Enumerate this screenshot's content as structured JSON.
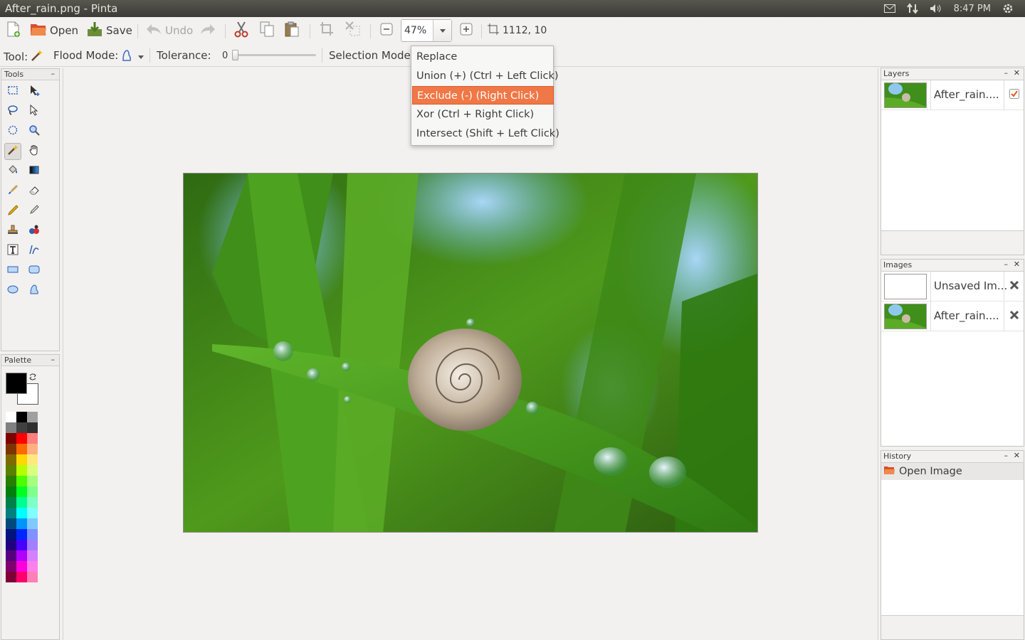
{
  "window": {
    "title": "After_rain.png - Pinta"
  },
  "tray": {
    "clock": "8:47 PM"
  },
  "toolbar": {
    "open_label": "Open",
    "save_label": "Save",
    "undo_label": "Undo",
    "zoom_value": "47%",
    "cursor_position": "1112, 10"
  },
  "tool_options": {
    "tool_label": "Tool:",
    "flood_mode_label": "Flood Mode:",
    "tolerance_label": "Tolerance:",
    "tolerance_value": "0",
    "tolerance_fraction": 0,
    "selection_mode_label": "Selection Mode:"
  },
  "selection_menu": {
    "items": [
      {
        "label": "Replace",
        "highlighted": false
      },
      {
        "label": "Union (+) (Ctrl + Left Click)",
        "highlighted": false
      },
      {
        "label": "Exclude (-) (Right Click)",
        "highlighted": true
      },
      {
        "label": "Xor (Ctrl + Right Click)",
        "highlighted": false
      },
      {
        "label": "Intersect (Shift + Left Click)",
        "highlighted": false
      }
    ]
  },
  "panels": {
    "tools_title": "Tools",
    "palette_title": "Palette",
    "layers_title": "Layers",
    "images_title": "Images",
    "history_title": "History"
  },
  "layers": [
    {
      "name": "After_rain....",
      "visible": true
    }
  ],
  "images": [
    {
      "name": "Unsaved Im..."
    },
    {
      "name": "After_rain...."
    }
  ],
  "history": [
    {
      "label": "Open Image"
    }
  ],
  "colors": {
    "accent": "#f07746",
    "primary_color": "#000000",
    "secondary_color": "#ffffff",
    "palette": [
      [
        "#ffffff",
        "#000000",
        "#a0a0a0"
      ],
      [
        "#808080",
        "#404040",
        "#303030"
      ],
      [
        "#7f0000",
        "#ff0000",
        "#ff7f7f"
      ],
      [
        "#7f3300",
        "#ff6a00",
        "#ffb27f"
      ],
      [
        "#7f6a00",
        "#ffd800",
        "#ffe97f"
      ],
      [
        "#5b7f00",
        "#b6ff00",
        "#daff7f"
      ],
      [
        "#267f00",
        "#4cff00",
        "#a5ff7f"
      ],
      [
        "#007f0e",
        "#00ff21",
        "#7fff8e"
      ],
      [
        "#007f46",
        "#00ff90",
        "#7fffc5"
      ],
      [
        "#007f7f",
        "#00ffff",
        "#7fffff"
      ],
      [
        "#004a7f",
        "#0094ff",
        "#7fc9ff"
      ],
      [
        "#00137f",
        "#0026ff",
        "#7f92ff"
      ],
      [
        "#21007f",
        "#4800ff",
        "#a17fff"
      ],
      [
        "#57007f",
        "#b200ff",
        "#d67fff"
      ],
      [
        "#7f006e",
        "#ff00dc",
        "#ff7fed"
      ],
      [
        "#7f0037",
        "#ff006e",
        "#ff7fb6"
      ]
    ]
  },
  "icons": {
    "new": "new-image-icon",
    "open": "open-folder-icon",
    "save": "save-icon",
    "undo": "undo-icon",
    "redo": "redo-icon",
    "cut": "scissors-icon",
    "copy": "copy-icon",
    "paste": "paste-icon",
    "crop": "crop-icon",
    "deselect": "deselect-icon",
    "zoom_out": "zoom-out-icon",
    "zoom_in": "zoom-in-icon"
  }
}
